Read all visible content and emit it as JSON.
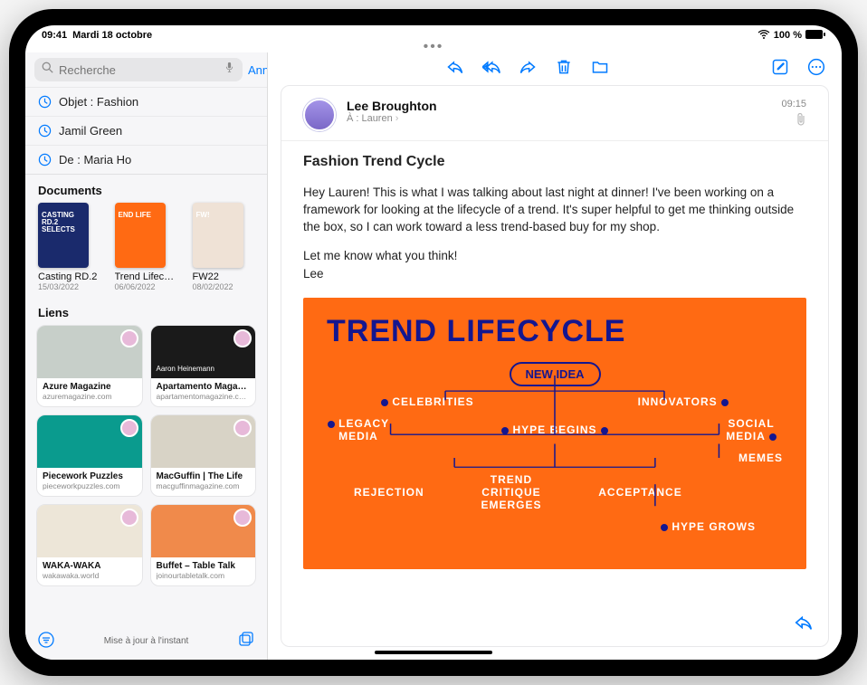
{
  "status": {
    "time": "09:41",
    "date": "Mardi 18 octobre",
    "battery": "100 %"
  },
  "search": {
    "placeholder": "Recherche",
    "cancel": "Annuler"
  },
  "recents": [
    "Objet : Fashion",
    "Jamil Green",
    "De : Maria Ho"
  ],
  "documents": {
    "header": "Documents",
    "items": [
      {
        "name": "Casting RD.2",
        "date": "15/03/2022",
        "bg": "#1a2a6c",
        "label": "CASTING RD.2 SELECTS"
      },
      {
        "name": "Trend Lifecycle",
        "date": "06/06/2022",
        "bg": "#ff6a13",
        "label": "END LIFE"
      },
      {
        "name": "FW22",
        "date": "08/02/2022",
        "bg": "#efe2d6",
        "label": "FW!"
      }
    ]
  },
  "links": {
    "header": "Liens",
    "items": [
      {
        "title": "Azure Magazine",
        "url": "azuremagazine.com",
        "bg": "#c7cfc9"
      },
      {
        "title": "Apartamento Maga…",
        "url": "apartamentomagazine.c…",
        "bg": "#1a1a1a",
        "label": "Aaron Heinemann"
      },
      {
        "title": "Piecework Puzzles",
        "url": "pieceworkpuzzles.com",
        "bg": "#0a9b8e"
      },
      {
        "title": "MacGuffin | The Life",
        "url": "macguffinmagazine.com",
        "bg": "#d8d3c6"
      },
      {
        "title": "WAKA-WAKA",
        "url": "wakawaka.world",
        "bg": "#ede6d8"
      },
      {
        "title": "Buffet – Table Talk",
        "url": "joinourtabletalk.com",
        "bg": "#f08a4b"
      }
    ]
  },
  "footer": {
    "status": "Mise à jour à l'instant"
  },
  "mail": {
    "sender": "Lee Broughton",
    "to_label": "À :",
    "to_name": "Lauren",
    "time": "09:15",
    "subject": "Fashion Trend Cycle",
    "body_p1": "Hey Lauren! This is what I was talking about last night at dinner! I've been working on a framework for looking at the lifecycle of a trend. It's super helpful to get me thinking outside the box, so I can work toward a less trend-based buy for my shop.",
    "body_p2": "Let me know what you think!",
    "sig": "Lee"
  },
  "poster": {
    "title": "TREND LIFECYCLE",
    "nodes": {
      "new_idea": "NEW IDEA",
      "celebrities": "CELEBRITIES",
      "innovators": "INNOVATORS",
      "legacy": "LEGACY MEDIA",
      "hype_begins": "HYPE BEGINS",
      "social": "SOCIAL MEDIA",
      "memes": "MEMES",
      "rejection": "REJECTION",
      "critique": "TREND CRITIQUE EMERGES",
      "acceptance": "ACCEPTANCE",
      "hype_grows": "HYPE GROWS"
    }
  }
}
